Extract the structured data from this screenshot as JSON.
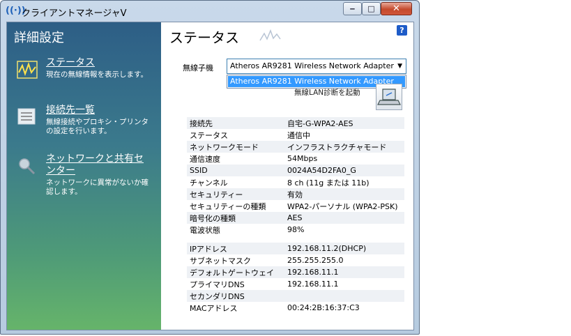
{
  "window": {
    "title": "クライアントマネージャV",
    "controls": {
      "minimize": "‒",
      "maximize": "□",
      "close": "✕"
    }
  },
  "sidebar": {
    "title": "詳細設定",
    "items": [
      {
        "label": "ステータス",
        "description": "現在の無線情報を表示します。",
        "icon": "status-wave-icon"
      },
      {
        "label": "接続先一覧",
        "description": "無線接続やプロキシ・プリンタの設定を行います。",
        "icon": "list-icon"
      },
      {
        "label": "ネットワークと共有センター",
        "description": "ネットワークに異常がないか確認します。",
        "icon": "magnifier-icon"
      }
    ]
  },
  "main": {
    "title": "ステータス",
    "help": "?",
    "adapter_label": "無線子機",
    "adapter_selected": "Atheros AR9281 Wireless Network Adapter",
    "adapter_options": [
      "Atheros AR9281 Wireless Network Adapter"
    ],
    "diagnose_label": "無線LAN診断を起動",
    "connection_info": [
      {
        "key": "接続先",
        "value": "自宅-G-WPA2-AES"
      },
      {
        "key": "ステータス",
        "value": "通信中"
      },
      {
        "key": "ネットワークモード",
        "value": "インフラストラクチャモード"
      },
      {
        "key": "通信速度",
        "value": "54Mbps"
      },
      {
        "key": "SSID",
        "value": "0024A54D2FA0_G"
      },
      {
        "key": "チャンネル",
        "value": "8 ch (11g または 11b)"
      },
      {
        "key": "セキュリティー",
        "value": "有効"
      },
      {
        "key": "セキュリティーの種類",
        "value": "WPA2-パーソナル (WPA2-PSK)"
      },
      {
        "key": "暗号化の種類",
        "value": "AES"
      },
      {
        "key": "電波状態",
        "value": "98%"
      }
    ],
    "network_info": [
      {
        "key": "IPアドレス",
        "value": "192.168.11.2(DHCP)"
      },
      {
        "key": "サブネットマスク",
        "value": "255.255.255.0"
      },
      {
        "key": "デフォルトゲートウェイ",
        "value": "192.168.11.1"
      },
      {
        "key": "プライマリDNS",
        "value": "192.168.11.1"
      },
      {
        "key": "セカンダリDNS",
        "value": ""
      },
      {
        "key": "MACアドレス",
        "value": "00:24:2B:16:37:C3"
      }
    ]
  },
  "colors": {
    "accent": "#3399ff",
    "help_badge": "#1e5cc8"
  }
}
